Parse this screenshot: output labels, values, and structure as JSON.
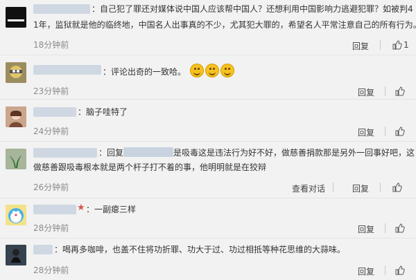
{
  "comments": [
    {
      "text1": "：自己犯了罪还对媒体说中国人应该帮中国人？还想利用中国影响力逃避犯罪？如被判4",
      "text2": "1年，监狱就是他的临终地，中国名人出事真的不少，尤其犯大罪的，希望名人平常注意自己的所有行为。",
      "time": "18分钟前",
      "reply": "回复",
      "like_count": "1"
    },
    {
      "text1": "：评论出奇的一致哈。",
      "time": "23分钟前",
      "reply": "回复"
    },
    {
      "text1": "：脑子哇特了",
      "time": "24分钟前",
      "reply": "回复"
    },
    {
      "text1a": "：回复",
      "text1b": "是吸毒这是违法行为好不好，做慈善捐款那是另外一回事好吧，这",
      "text2": "做慈善跟吸毒根本就是两个杆子打不着的事，他明明就是在狡辩",
      "time": "26分钟前",
      "view_thread": "查看对话",
      "reply": "回复"
    },
    {
      "text1": "：一副瘪三样",
      "time": "28分钟前",
      "reply": "回复"
    },
    {
      "text1": "：喝再多咖啡，也盖不住将功折罪、功大于过、功过相抵等种花思维的大蒜味。",
      "time": "28分钟前",
      "reply": "回复"
    }
  ],
  "icons": [
    "like-icon",
    "laughing-emoji-icon"
  ],
  "colors": {
    "background": "#f2f2f2",
    "time": "#8a8a8a",
    "name_blur": "#c9d3df"
  }
}
